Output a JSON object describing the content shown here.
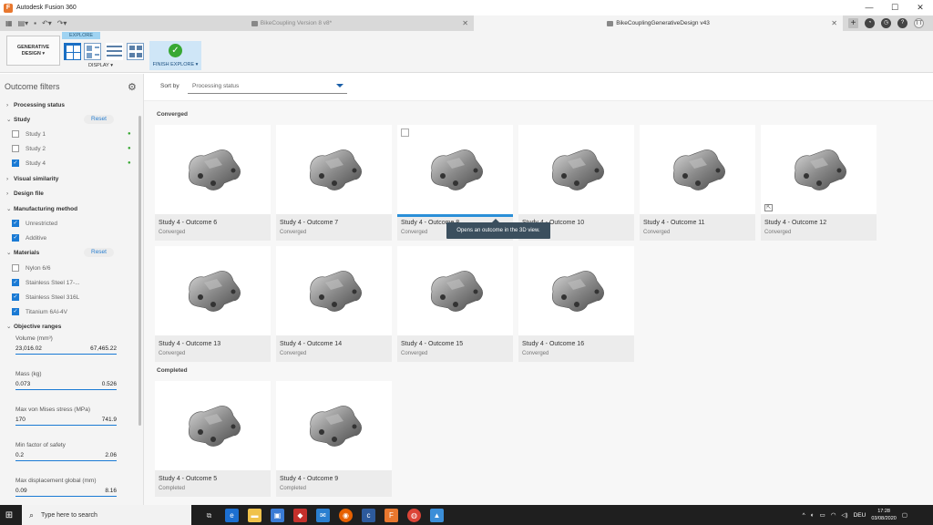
{
  "window": {
    "title": "Autodesk Fusion 360",
    "app_icon": "F",
    "minimize": "—",
    "maximize": "☐",
    "close": "✕"
  },
  "tabs": [
    {
      "label": "BikeCoupling Version 8 v8*",
      "active": false
    },
    {
      "label": "BikeCouplingGenerativeDesign v43",
      "active": true
    }
  ],
  "toolbar": {
    "workspace": "GENERATIVE DESIGN",
    "explore": "EXPLORE",
    "display": "DISPLAY ▾",
    "finish": "FINISH EXPLORE ▾"
  },
  "sidebar": {
    "title": "Outcome filters",
    "reset": "Reset",
    "sections": {
      "processing_status": "Processing status",
      "study": "Study",
      "visual_similarity": "Visual similarity",
      "design_file": "Design file",
      "manufacturing_method": "Manufacturing method",
      "materials": "Materials",
      "objective_ranges": "Objective ranges"
    },
    "studies": [
      {
        "label": "Study 1",
        "checked": false
      },
      {
        "label": "Study 2",
        "checked": false
      },
      {
        "label": "Study 4",
        "checked": true
      }
    ],
    "methods": [
      {
        "label": "Unrestricted",
        "checked": true
      },
      {
        "label": "Additive",
        "checked": true
      }
    ],
    "materials": [
      {
        "label": "Nylon 6/6",
        "checked": false
      },
      {
        "label": "Stainless Steel 17-...",
        "checked": true
      },
      {
        "label": "Stainless Steel 316L",
        "checked": true
      },
      {
        "label": "Titanium 6Al-4V",
        "checked": true
      }
    ],
    "ranges": [
      {
        "label": "Volume (mm³)",
        "min": "23,016.02",
        "max": "67,465.22"
      },
      {
        "label": "Mass (kg)",
        "min": "0.073",
        "max": "0.526"
      },
      {
        "label": "Max von Mises stress (MPa)",
        "min": "170",
        "max": "741.9"
      },
      {
        "label": "Min factor of safety",
        "min": "0.2",
        "max": "2.06"
      },
      {
        "label": "Max displacement global (mm)",
        "min": "0.09",
        "max": "8.16"
      }
    ]
  },
  "sort": {
    "label": "Sort by",
    "value": "Processing status"
  },
  "groups": {
    "converged": "Converged",
    "completed": "Completed"
  },
  "outcomes": [
    {
      "name": "Study 4 - Outcome 6",
      "status": "Converged"
    },
    {
      "name": "Study 4 - Outcome 7",
      "status": "Converged"
    },
    {
      "name": "Study 4 - Outcome 8",
      "status": "Converged"
    },
    {
      "name": "Study 4 - Outcome 10",
      "status": "Converged"
    },
    {
      "name": "Study 4 - Outcome 11",
      "status": "Converged"
    },
    {
      "name": "Study 4 - Outcome 12",
      "status": "Converged"
    },
    {
      "name": "Study 4 - Outcome 13",
      "status": "Converged"
    },
    {
      "name": "Study 4 - Outcome 14",
      "status": "Converged"
    },
    {
      "name": "Study 4 - Outcome 15",
      "status": "Converged"
    },
    {
      "name": "Study 4 - Outcome 16",
      "status": "Converged"
    },
    {
      "name": "Study 4 - Outcome 5",
      "status": "Completed"
    },
    {
      "name": "Study 4 - Outcome 9",
      "status": "Completed"
    }
  ],
  "tooltip": "Opens an outcome in the 3D view.",
  "taskbar": {
    "search_placeholder": "Type here to search",
    "lang": "DEU",
    "time": "17:28",
    "date": "03/08/2020"
  },
  "colors": {
    "accent": "#1a7ad4",
    "finish_green": "#38a833",
    "highlight": "#2a8fd8"
  }
}
